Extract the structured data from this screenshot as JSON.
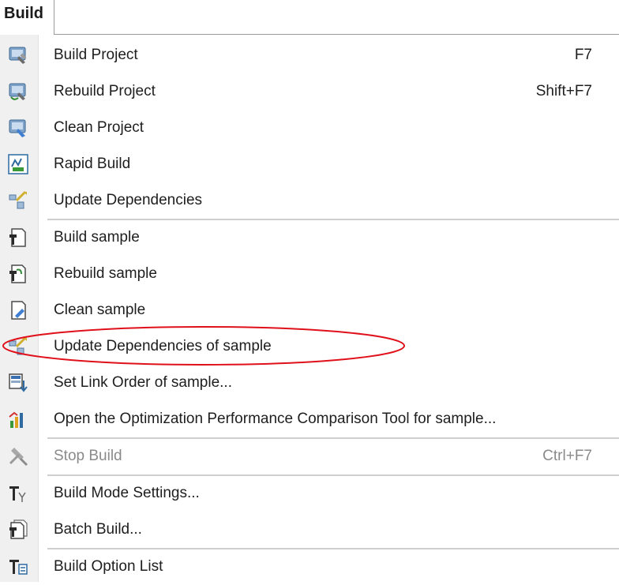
{
  "menu": {
    "title": "Build",
    "items": [
      {
        "label": "Build Project",
        "shortcut": "F7",
        "icon": "build-project-icon"
      },
      {
        "label": "Rebuild Project",
        "shortcut": "Shift+F7",
        "icon": "rebuild-project-icon"
      },
      {
        "label": "Clean Project",
        "shortcut": "",
        "icon": "clean-project-icon"
      },
      {
        "label": "Rapid Build",
        "shortcut": "",
        "icon": "rapid-build-icon"
      },
      {
        "label": "Update Dependencies",
        "shortcut": "",
        "icon": "update-dependencies-icon"
      },
      {
        "label": "Build sample",
        "shortcut": "",
        "icon": "build-sample-icon"
      },
      {
        "label": "Rebuild sample",
        "shortcut": "",
        "icon": "rebuild-sample-icon"
      },
      {
        "label": "Clean sample",
        "shortcut": "",
        "icon": "clean-sample-icon"
      },
      {
        "label": "Update Dependencies of sample",
        "shortcut": "",
        "icon": "update-dependencies-sample-icon"
      },
      {
        "label": "Set Link Order of sample...",
        "shortcut": "",
        "icon": "link-order-icon"
      },
      {
        "label": "Open the Optimization Performance Comparison Tool for sample...",
        "shortcut": "",
        "icon": "performance-chart-icon"
      },
      {
        "label": "Stop Build",
        "shortcut": "Ctrl+F7",
        "icon": "stop-build-icon",
        "disabled": true
      },
      {
        "label": "Build Mode Settings...",
        "shortcut": "",
        "icon": "build-mode-icon"
      },
      {
        "label": "Batch Build...",
        "shortcut": "",
        "icon": "batch-build-icon"
      },
      {
        "label": "Build Option List",
        "shortcut": "",
        "icon": "build-option-list-icon"
      }
    ]
  },
  "annotation": {
    "highlighted_item": "Update Dependencies of sample",
    "color": "#e0101a"
  }
}
